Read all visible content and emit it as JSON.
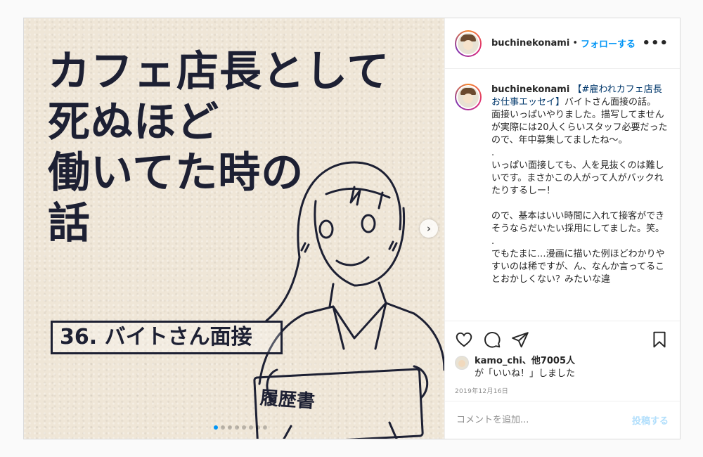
{
  "media": {
    "title_lines": [
      "カフェ店長として",
      "死ぬほど",
      "働いてた時の",
      "話"
    ],
    "episode_label": "36. バイトさん面接",
    "resume_label": "履歴書",
    "next_icon": "chevron-right-icon"
  },
  "header": {
    "username": "buchinekonami",
    "separator": "•",
    "follow_label": "フォローする",
    "more_icon": "more-horizontal-icon",
    "more_label": "•••"
  },
  "caption": {
    "username": "buchinekonami",
    "hashtag": "【#雇われカフェ店長お仕事エッセイ】",
    "body": "バイトさん面接の話。\n面接いっぱいやりました。描写してませんが実際には20人くらいスタッフ必要だったので、年中募集してましたね〜。\n.\nいっぱい面接しても、人を見抜くのは難しいです。まさかこの人がって人がバックれたりするしー！\n\nので、基本はいい時間に入れて接客ができそうならだいたい採用にしてました。笑。\n.\nでもたまに…漫画に描いた例ほどわかりやすいのは稀ですが、ん、なんか言ってることおかしくない？みたいな違"
  },
  "actions": {
    "like_icon": "heart-icon",
    "comment_icon": "comment-icon",
    "share_icon": "send-icon",
    "save_icon": "bookmark-icon"
  },
  "likes": {
    "first_user": "kamo_chi",
    "others": "、他7005人",
    "suffix": "が「いいね！」しました"
  },
  "date": "2019年12月16日",
  "comment_box": {
    "placeholder": "コメントを追加...",
    "post_label": "投稿する"
  },
  "colors": {
    "accent": "#0095f6",
    "post_disabled": "#b2dffc",
    "ink": "#1d2033",
    "paper": "#efe6d7"
  }
}
